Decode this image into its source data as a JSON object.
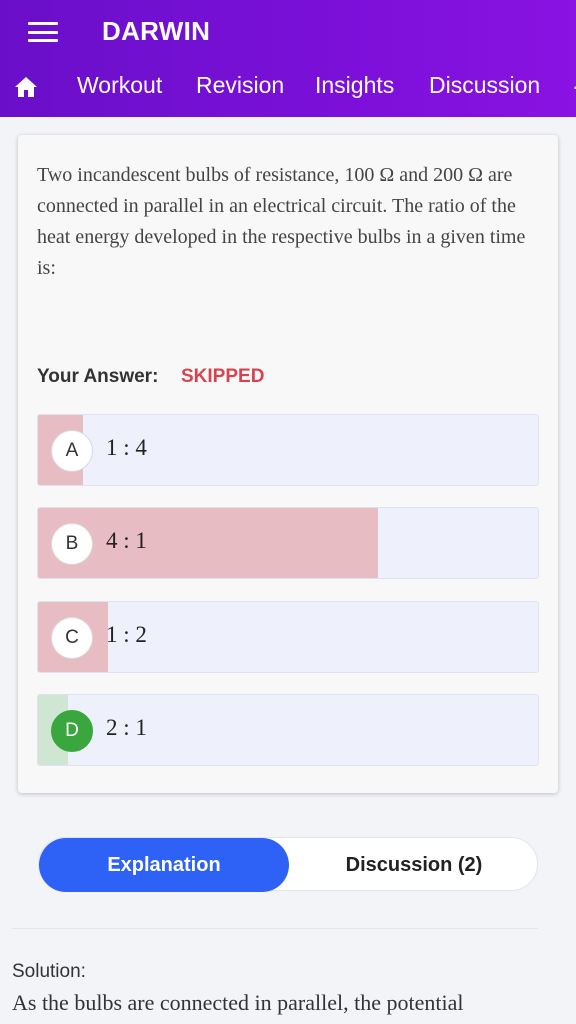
{
  "app": {
    "title": "DARWIN"
  },
  "nav": {
    "items": [
      {
        "label": "Workout"
      },
      {
        "label": "Revision"
      },
      {
        "label": "Insights"
      },
      {
        "label": "Discussion"
      }
    ]
  },
  "question": {
    "text": "Two incandescent bulbs of resistance, 100 Ω and 200 Ω are connected in parallel in an electrical circuit. The ratio of the heat energy developed in the respective bulbs in a given time is:",
    "your_answer_label": "Your Answer:",
    "your_answer_value": "SKIPPED",
    "options": [
      {
        "letter": "A",
        "text": "1 : 4",
        "fill_color": "#e8bcc3",
        "fill_fraction": 0.09
      },
      {
        "letter": "B",
        "text": "4 : 1",
        "fill_color": "#e8bcc3",
        "fill_fraction": 0.68
      },
      {
        "letter": "C",
        "text": "1 : 2",
        "fill_color": "#e8bcc3",
        "fill_fraction": 0.14
      },
      {
        "letter": "D",
        "text": "2 : 1",
        "fill_color": "#cfe6d3",
        "fill_fraction": 0.06,
        "correct": true
      }
    ]
  },
  "tabs": {
    "explanation": "Explanation",
    "discussion": "Discussion (2)"
  },
  "solution": {
    "title": "Solution:",
    "text": "As the bulbs are connected in parallel, the potential"
  },
  "colors": {
    "accent": "#7a10d8",
    "primary_button": "#2e62f6",
    "skipped": "#d6454f",
    "correct": "#3aa63e"
  }
}
